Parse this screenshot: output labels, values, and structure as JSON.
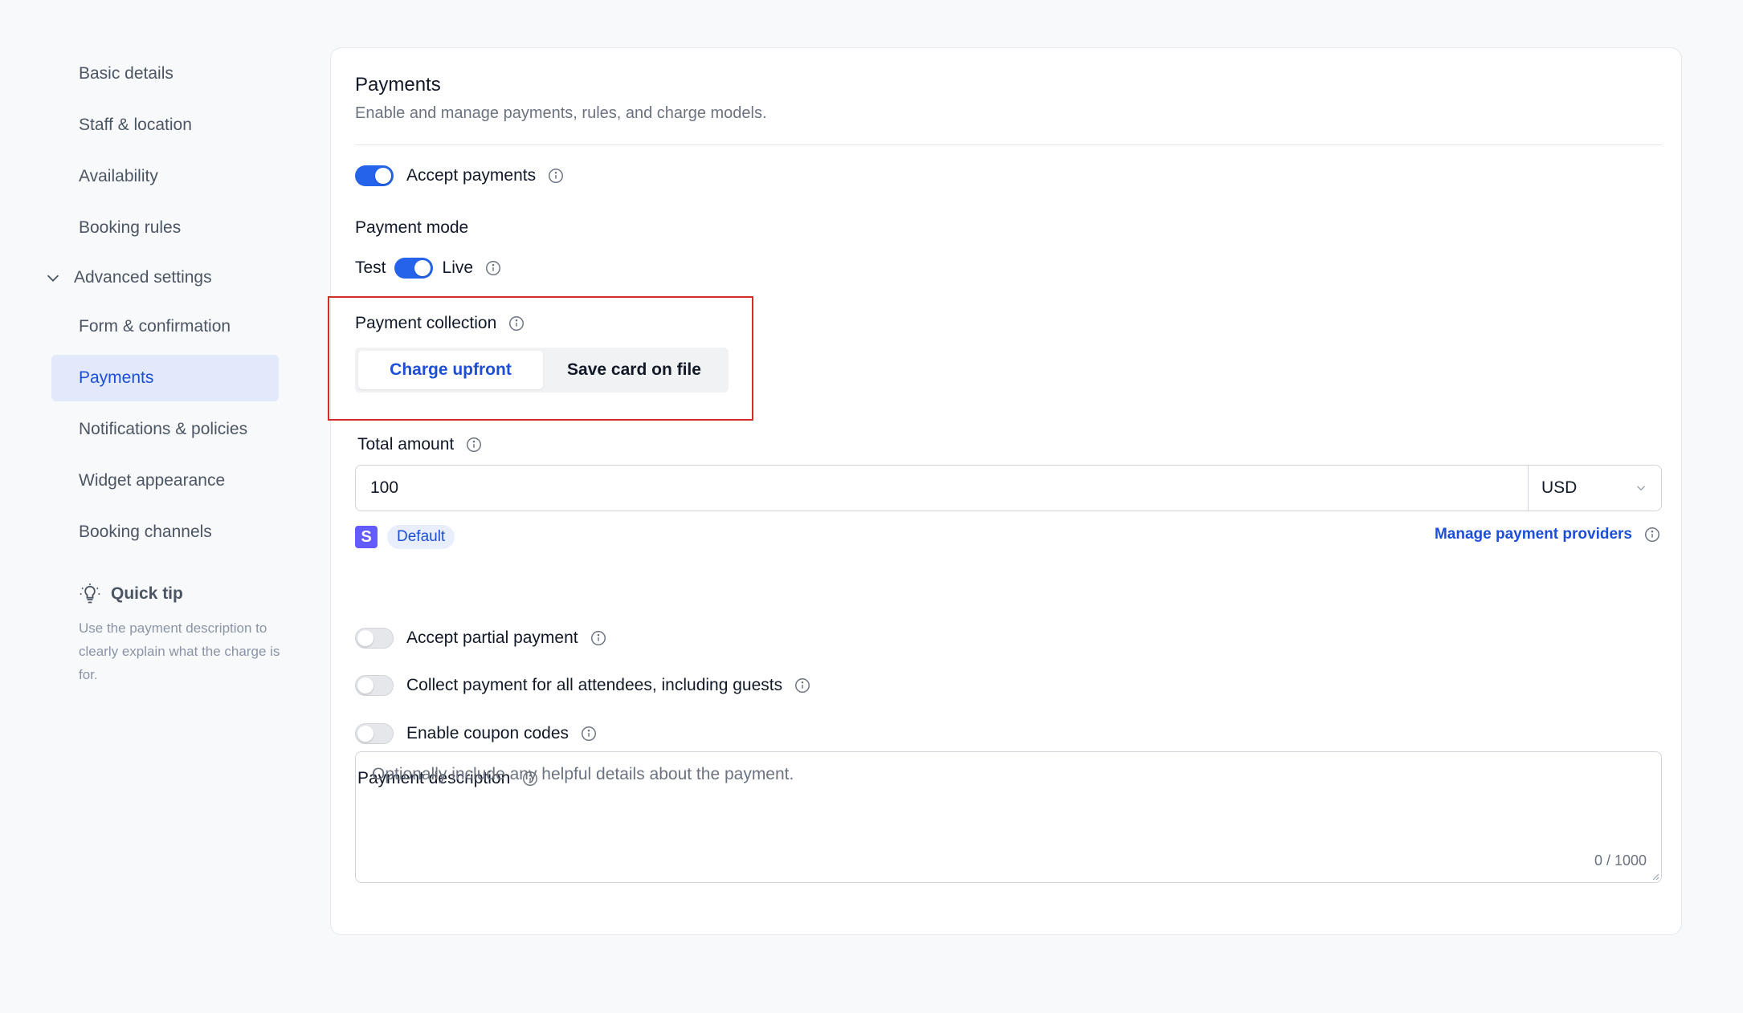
{
  "sidebar": {
    "items_top": [
      "Basic details",
      "Staff & location",
      "Availability",
      "Booking rules"
    ],
    "group_label": "Advanced settings",
    "items_sub": [
      "Form & confirmation",
      "Payments",
      "Notifications & policies",
      "Widget appearance",
      "Booking channels"
    ],
    "active_item": "Payments",
    "tip": {
      "title": "Quick tip",
      "body": "Use the payment description to clearly explain what the charge is for."
    }
  },
  "card": {
    "title": "Payments",
    "subtitle": "Enable and manage payments, rules, and charge models.",
    "accept_payments": {
      "label": "Accept payments",
      "enabled": true
    },
    "payment_mode": {
      "label": "Payment mode",
      "left": "Test",
      "right": "Live",
      "value": "Live"
    },
    "payment_collection": {
      "label": "Payment collection",
      "options": [
        "Charge upfront",
        "Save card on file"
      ],
      "selected": "Charge upfront"
    },
    "total_amount": {
      "label": "Total amount",
      "value": "100",
      "currency": "USD"
    },
    "provider": {
      "icon_letter": "S",
      "badge": "Default",
      "manage_link": "Manage payment providers"
    },
    "toggles": [
      {
        "label": "Accept partial payment",
        "enabled": false
      },
      {
        "label": "Collect payment for all attendees, including guests",
        "enabled": false
      },
      {
        "label": "Enable coupon codes",
        "enabled": false
      }
    ],
    "payment_description": {
      "label": "Payment description",
      "placeholder": "Optionally include any helpful details about the payment.",
      "counter": "0 / 1000"
    }
  },
  "colors": {
    "accent": "#2563eb",
    "highlight_border": "#d42b2b",
    "stripe": "#635bff"
  }
}
